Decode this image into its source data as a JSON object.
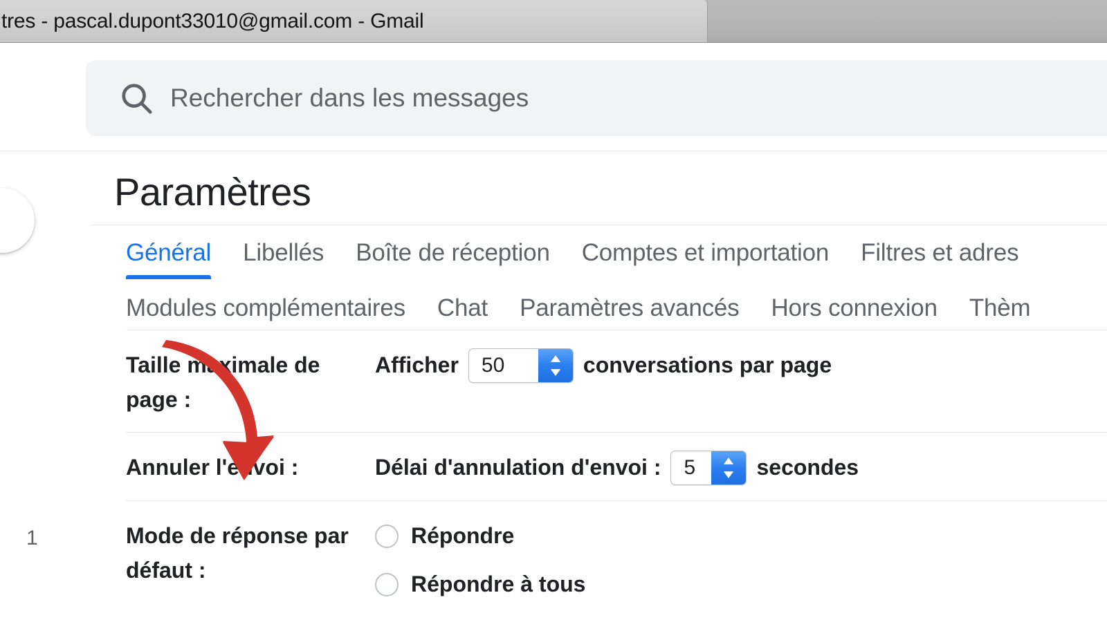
{
  "browser": {
    "tab_title": "tres - pascal.dupont33010@gmail.com - Gmail"
  },
  "search": {
    "icon": "search-icon",
    "placeholder": "Rechercher dans les messages",
    "value": ""
  },
  "settings": {
    "page_title": "Paramètres",
    "tabs_row1": [
      {
        "label": "Général",
        "active": true
      },
      {
        "label": "Libellés",
        "active": false
      },
      {
        "label": "Boîte de réception",
        "active": false
      },
      {
        "label": "Comptes et importation",
        "active": false
      },
      {
        "label": "Filtres et adres",
        "active": false
      }
    ],
    "tabs_row2": [
      {
        "label": "Modules complémentaires",
        "active": false
      },
      {
        "label": "Chat",
        "active": false
      },
      {
        "label": "Paramètres avancés",
        "active": false
      },
      {
        "label": "Hors connexion",
        "active": false
      },
      {
        "label": "Thèm",
        "active": false
      }
    ],
    "rows": [
      {
        "label": "Taille maximale de page :",
        "prefix": "Afficher",
        "select_value": "50",
        "suffix": "conversations par page"
      },
      {
        "label": "Annuler l'envoi :",
        "prefix": "Délai d'annulation d'envoi :",
        "select_value": "5",
        "suffix": "secondes"
      }
    ],
    "reply_row": {
      "label": "Mode de réponse par défaut :",
      "options": [
        {
          "label": "Répondre",
          "selected": false
        },
        {
          "label": "Répondre à tous",
          "selected": false
        }
      ]
    },
    "page_number": "1"
  },
  "annotation": {
    "arrow_color": "#d3342c",
    "icon": "curved-down-arrow-icon"
  },
  "colors": {
    "accent_blue": "#1a73e8",
    "text_primary": "#202124",
    "text_secondary": "#5f6368",
    "search_bg": "#f1f3f4",
    "annotation_red": "#d3342c"
  }
}
